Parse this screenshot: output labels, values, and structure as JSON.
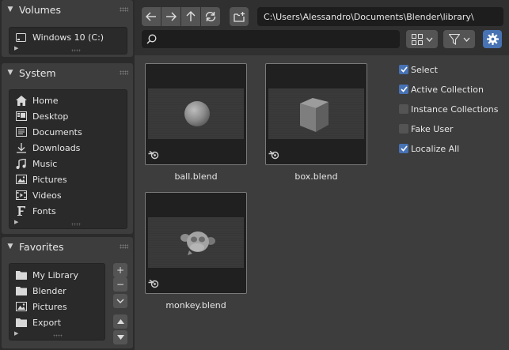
{
  "sidebar": {
    "volumes": {
      "title": "Volumes",
      "items": [
        {
          "label": "Windows 10 (C:)",
          "icon": "drive-icon"
        }
      ]
    },
    "system": {
      "title": "System",
      "items": [
        {
          "label": "Home",
          "icon": "home-icon"
        },
        {
          "label": "Desktop",
          "icon": "desktop-icon"
        },
        {
          "label": "Documents",
          "icon": "documents-icon"
        },
        {
          "label": "Downloads",
          "icon": "download-icon"
        },
        {
          "label": "Music",
          "icon": "music-icon"
        },
        {
          "label": "Pictures",
          "icon": "image-icon"
        },
        {
          "label": "Videos",
          "icon": "video-icon"
        },
        {
          "label": "Fonts",
          "icon": "font-icon"
        }
      ]
    },
    "favorites": {
      "title": "Favorites",
      "items": [
        {
          "label": "My Library",
          "icon": "folder-icon"
        },
        {
          "label": "Blender",
          "icon": "folder-icon"
        },
        {
          "label": "Pictures",
          "icon": "image-icon"
        },
        {
          "label": "Export",
          "icon": "folder-icon"
        }
      ],
      "buttons": {
        "add": "+",
        "remove": "−"
      }
    }
  },
  "toolbar": {
    "path": "C:\\Users\\Alessandro\\Documents\\Blender\\library\\",
    "search_value": ""
  },
  "files": [
    {
      "name": "ball.blend",
      "preview": "sphere"
    },
    {
      "name": "box.blend",
      "preview": "cube"
    },
    {
      "name": "monkey.blend",
      "preview": "monkey"
    }
  ],
  "options": [
    {
      "label": "Select",
      "checked": true
    },
    {
      "label": "Active Collection",
      "checked": true
    },
    {
      "label": "Instance Collections",
      "checked": false
    },
    {
      "label": "Fake User",
      "checked": false
    },
    {
      "label": "Localize All",
      "checked": true
    }
  ],
  "colors": {
    "accent": "#4772b3",
    "panel": "#3d3d3d",
    "background": "#303030",
    "field": "#1d1d1d"
  }
}
